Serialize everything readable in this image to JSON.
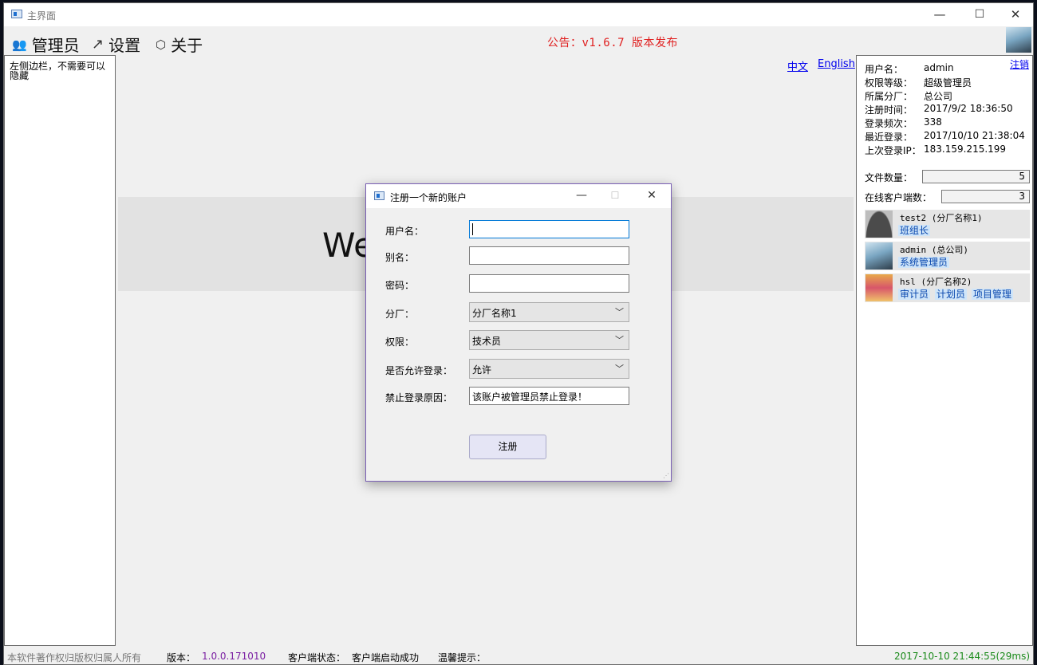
{
  "window": {
    "title": "主界面",
    "minimize": "—",
    "maximize": "☐",
    "close": "✕"
  },
  "menu": {
    "items": [
      {
        "label": "管理员",
        "icon": "users-icon",
        "glyph": "👥"
      },
      {
        "label": "设置",
        "icon": "arrow-icon",
        "glyph": "↗"
      },
      {
        "label": "关于",
        "icon": "cube-icon",
        "glyph": "⬡"
      }
    ],
    "notice": "公告：v1.6.7 版本发布"
  },
  "sidebar": {
    "text": "左侧边栏，不需要可以隐藏"
  },
  "main": {
    "lang_cn": "中文",
    "lang_en": "English",
    "welcome": "We"
  },
  "user": {
    "logout": "注销",
    "rows": [
      {
        "k": "用户名：",
        "v": "admin"
      },
      {
        "k": "权限等级：",
        "v": "超级管理员"
      },
      {
        "k": "所属分厂：",
        "v": "总公司"
      },
      {
        "k": "注册时间：",
        "v": "2017/9/2 18:36:50"
      },
      {
        "k": "登录频次：",
        "v": "338"
      },
      {
        "k": "最近登录：",
        "v": "2017/10/10 21:38:04"
      },
      {
        "k": "上次登录IP：",
        "v": "183.159.215.199"
      }
    ],
    "file_count_label": "文件数量：",
    "file_count": "5",
    "online_label": "在线客户端数：",
    "online_count": "3"
  },
  "clients": [
    {
      "name": "test2 (分厂名称1)",
      "roles": [
        "班组长"
      ]
    },
    {
      "name": "admin (总公司)",
      "roles": [
        "系统管理员"
      ]
    },
    {
      "name": "hsl (分厂名称2)",
      "roles": [
        "审计员",
        "计划员",
        "项目管理"
      ]
    }
  ],
  "status": {
    "copyright": "本软件著作权归版权归属人所有",
    "version_label": "版本：",
    "version": "1.0.0.171010",
    "client_status_label": "客户端状态：",
    "client_status": "客户端启动成功",
    "tip_label": "温馨提示：",
    "timestamp": "2017-10-10 21:44:55(29ms)"
  },
  "dialog": {
    "title": "注册一个新的账户",
    "fields": {
      "username_label": "用户名：",
      "alias_label": "别名：",
      "password_label": "密码：",
      "factory_label": "分厂：",
      "factory_value": "分厂名称1",
      "role_label": "权限：",
      "role_value": "技术员",
      "allow_label": "是否允许登录：",
      "allow_value": "允许",
      "reason_label": "禁止登录原因：",
      "reason_value": "该账户被管理员禁止登录！"
    },
    "submit": "注册"
  },
  "colors": {
    "notice": "#e02020",
    "link": "#0000ee",
    "version": "#7a1fa2",
    "timestamp": "#1a8a1a",
    "dialog_border": "#7a5fb5"
  }
}
